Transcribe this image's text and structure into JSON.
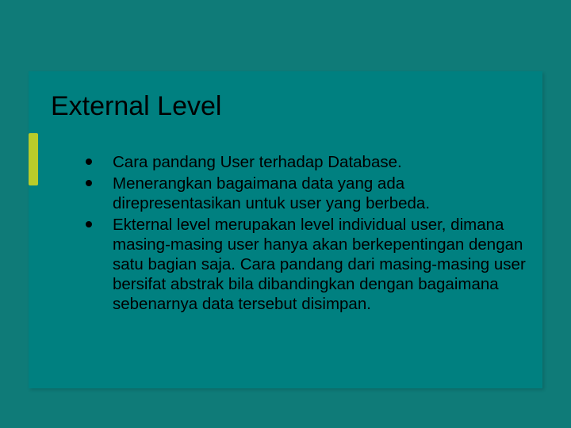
{
  "slide": {
    "title": "External Level",
    "bullets": [
      "Cara pandang User terhadap Database.",
      "Menerangkan bagaimana data yang ada direpresentasikan untuk user yang berbeda.",
      "Ekternal level merupakan level individual user, dimana masing-masing user hanya akan berkepentingan dengan satu bagian saja. Cara pandang dari masing-masing user bersifat abstrak bila dibandingkan dengan bagaimana sebenarnya data tersebut disimpan."
    ]
  }
}
